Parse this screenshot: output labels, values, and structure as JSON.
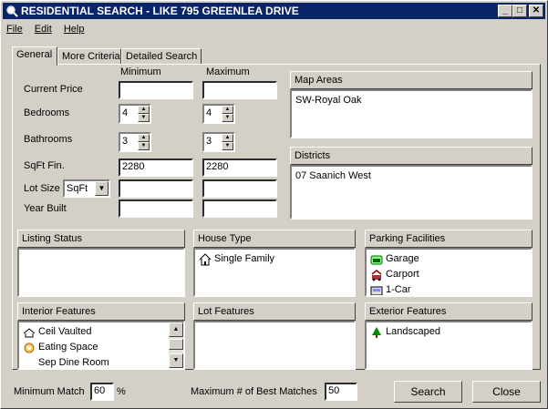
{
  "window": {
    "title": "RESIDENTIAL SEARCH - LIKE 795 GREENLEA DRIVE",
    "minimize": "_",
    "maximize": "□",
    "close": "✕"
  },
  "menu": {
    "file": "File",
    "edit": "Edit",
    "help": "Help"
  },
  "tabs": [
    "General",
    "More Criteria",
    "Detailed Search"
  ],
  "criteria": {
    "min_header": "Minimum",
    "max_header": "Maximum",
    "current_price": {
      "label": "Current Price",
      "min": "",
      "max": ""
    },
    "bedrooms": {
      "label": "Bedrooms",
      "min": "4",
      "max": "4"
    },
    "bathrooms": {
      "label": "Bathrooms",
      "min": "3",
      "max": "3"
    },
    "sqft": {
      "label": "SqFt Fin.",
      "min": "2280",
      "max": "2280"
    },
    "lot_size": {
      "label": "Lot Size",
      "unit": "SqFt",
      "min": "",
      "max": ""
    },
    "year_built": {
      "label": "Year Built",
      "min": "",
      "max": ""
    }
  },
  "map_areas": {
    "title": "Map Areas",
    "items": [
      "SW-Royal Oak"
    ]
  },
  "districts": {
    "title": "Districts",
    "items": [
      "07 Saanich West"
    ]
  },
  "listing_status": {
    "title": "Listing Status",
    "items": []
  },
  "house_type": {
    "title": "House Type",
    "items": [
      {
        "label": "Single Family",
        "icon": "house-icon"
      }
    ]
  },
  "parking": {
    "title": "Parking Facilities",
    "items": [
      {
        "label": "Garage",
        "icon": "garage-icon"
      },
      {
        "label": "Carport",
        "icon": "carport-icon"
      },
      {
        "label": "1-Car",
        "icon": "car-icon"
      }
    ]
  },
  "interior": {
    "title": "Interior Features",
    "items": [
      {
        "label": "Ceil Vaulted",
        "icon": "vaulted-ceiling-icon"
      },
      {
        "label": "Eating Space",
        "icon": "eating-space-icon"
      },
      {
        "label": "Sep Dine Room",
        "icon": ""
      }
    ]
  },
  "lot_features": {
    "title": "Lot Features",
    "items": []
  },
  "exterior": {
    "title": "Exterior Features",
    "items": [
      {
        "label": "Landscaped",
        "icon": "tree-icon"
      }
    ]
  },
  "footer": {
    "min_match_label": "Minimum Match",
    "min_match_value": "60",
    "percent": "%",
    "max_best_label": "Maximum # of Best Matches",
    "max_best_value": "50",
    "search": "Search",
    "close": "Close"
  }
}
